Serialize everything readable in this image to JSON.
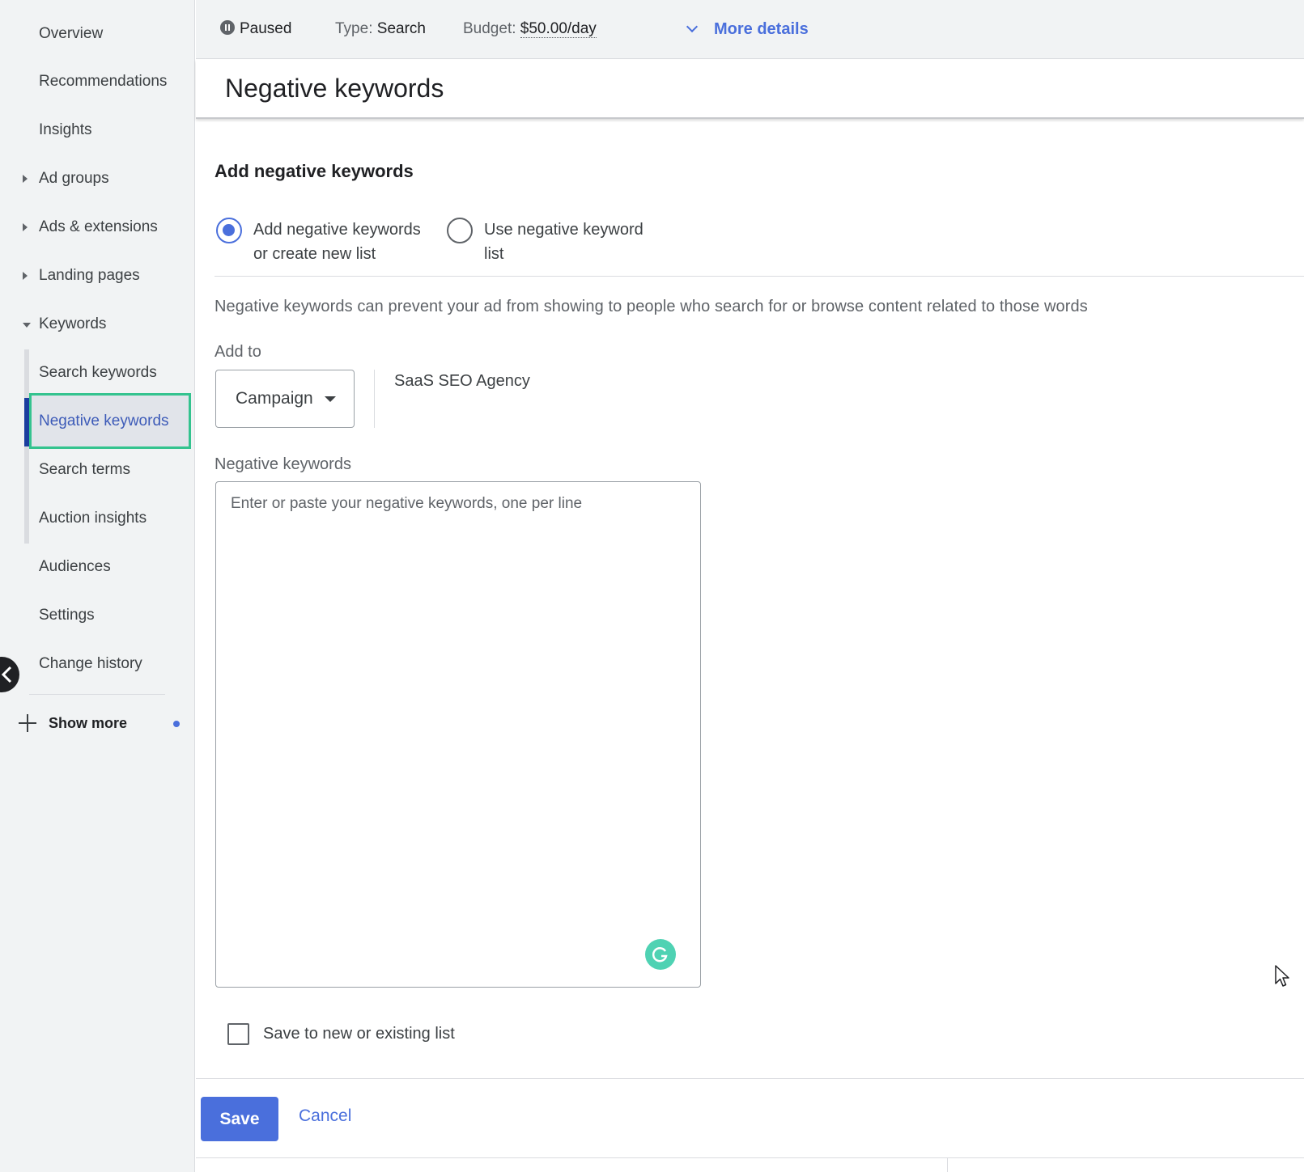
{
  "sidebar": {
    "items": [
      {
        "label": "Overview"
      },
      {
        "label": "Recommendations"
      },
      {
        "label": "Insights"
      },
      {
        "label": "Ad groups"
      },
      {
        "label": "Ads & extensions"
      },
      {
        "label": "Landing pages"
      },
      {
        "label": "Keywords"
      },
      {
        "label": "Search keywords"
      },
      {
        "label": "Negative keywords"
      },
      {
        "label": "Search terms"
      },
      {
        "label": "Auction insights"
      },
      {
        "label": "Audiences"
      },
      {
        "label": "Settings"
      },
      {
        "label": "Change history"
      }
    ],
    "show_more": "Show more"
  },
  "status": {
    "state": "Paused",
    "type_label": "Type:",
    "type_value": "Search",
    "budget_label": "Budget:",
    "budget_value": "$50.00/day",
    "more_details": "More details"
  },
  "page": {
    "title": "Negative keywords"
  },
  "form": {
    "section_title": "Add negative keywords",
    "radio_add_line1": "Add negative keywords",
    "radio_add_line2": "or create new list",
    "radio_use_line1": "Use negative keyword",
    "radio_use_line2": "list",
    "description": "Negative keywords can prevent your ad from showing to people who search for or browse content related to those words",
    "add_to_label": "Add to",
    "level_select": "Campaign",
    "campaign_name": "SaaS SEO Agency",
    "keywords_label": "Negative keywords",
    "keywords_placeholder": "Enter or paste your negative keywords, one per line",
    "keywords_value": "",
    "save_list_label": "Save to new or existing list"
  },
  "footer": {
    "save_label": "Save",
    "cancel_label": "Cancel"
  },
  "colors": {
    "accent": "#4a6fdc",
    "highlight_border": "#34c38f",
    "active_rail": "#1a3d9e"
  }
}
